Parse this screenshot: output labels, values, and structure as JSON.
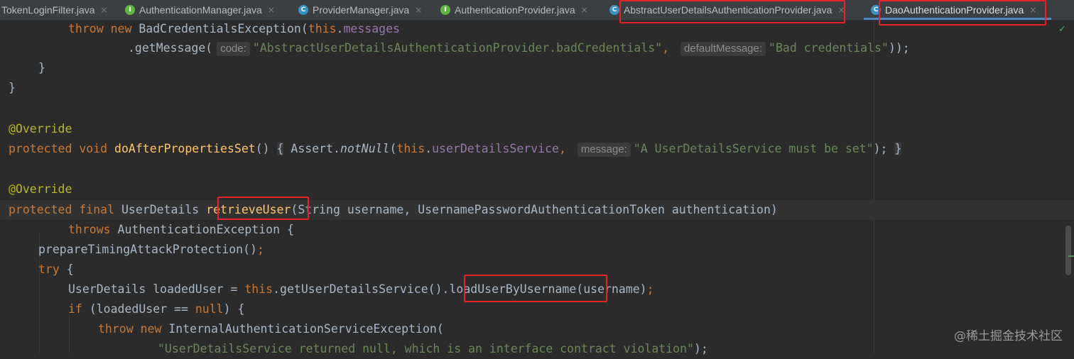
{
  "tabs": [
    {
      "label": "TokenLoginFilter.java",
      "icon": "class-icon",
      "close": "×"
    },
    {
      "label": "AuthenticationManager.java",
      "icon": "interface-icon",
      "close": "×"
    },
    {
      "label": "ProviderManager.java",
      "icon": "class-icon",
      "close": "×"
    },
    {
      "label": "AuthenticationProvider.java",
      "icon": "interface-icon",
      "close": "×"
    },
    {
      "label": "AbstractUserDetailsAuthenticationProvider.java",
      "icon": "class-icon",
      "close": "×"
    },
    {
      "label": "DaoAuthenticationProvider.java",
      "icon": "class-icon",
      "close": "×",
      "active": true
    }
  ],
  "icon_glyphs": {
    "interface": "I",
    "class": "C"
  },
  "status_mark": "✓",
  "code": {
    "l1": {
      "kw_throw": "throw",
      "kw_new": "new",
      "cls": "BadCredentialsException(",
      "kw_this": "this",
      "dot": ".",
      "fld": "messages"
    },
    "l2": {
      "call": ".getMessage(",
      "hint_code": "code:",
      "str_code": "\"AbstractUserDetailsAuthenticationProvider.badCredentials\"",
      "comma": ",",
      "hint_default": "defaultMessage:",
      "str_default": "\"Bad credentials\"",
      "end": "));"
    },
    "l3": "}",
    "l4": "}",
    "l6": "@Override",
    "l7": {
      "kw_protected": "protected",
      "kw_void": "void",
      "fn": "doAfterPropertiesSet",
      "parens": "()",
      "brace_open": "{",
      "assert": "Assert.",
      "notnull": "notNull",
      "paren": "(",
      "kw_this": "this",
      "dot": ".",
      "fld": "userDetailsService",
      "comma": ",",
      "hint_message": "message:",
      "str": "\"A UserDetailsService must be set\"",
      "end": ");",
      "brace_close": "}"
    },
    "l9": "@Override",
    "l10": {
      "kw_protected": "protected",
      "kw_final": "final",
      "type": "UserDetails",
      "fn": "retrieveUser",
      "params": "(String username, UsernamePasswordAuthenticationToken authentication)"
    },
    "l11": {
      "kw_throws": "throws",
      "rest": "AuthenticationException {"
    },
    "l12": {
      "call": "prepareTimingAttackProtection()",
      "semi": ";"
    },
    "l13": {
      "kw_try": "try",
      "rest": "{"
    },
    "l14": {
      "decl": "UserDetails loadedUser = ",
      "kw_this": "this",
      "get": ".getUserDetailsService()",
      "load": ".loadUserByUsername",
      "args": "(username)",
      "semi": ";"
    },
    "l15": {
      "kw_if": "if",
      "cond": "(loadedUser == ",
      "kw_null": "null",
      "rest": ") {"
    },
    "l16": {
      "kw_throw": "throw",
      "kw_new": "new",
      "cls": "InternalAuthenticationServiceException("
    },
    "l17": {
      "str": "\"UserDetailsService returned null, which is an interface contract violation\"",
      "end": ");"
    }
  },
  "colors": {
    "background": "#2b2b2b",
    "keyword": "#cc7832",
    "string": "#6a8759",
    "field": "#9876aa",
    "annotation": "#bbb529",
    "method_decl": "#ffc66d",
    "highlight_box": "#e8202a"
  },
  "watermark": "@稀土掘金技术社区"
}
